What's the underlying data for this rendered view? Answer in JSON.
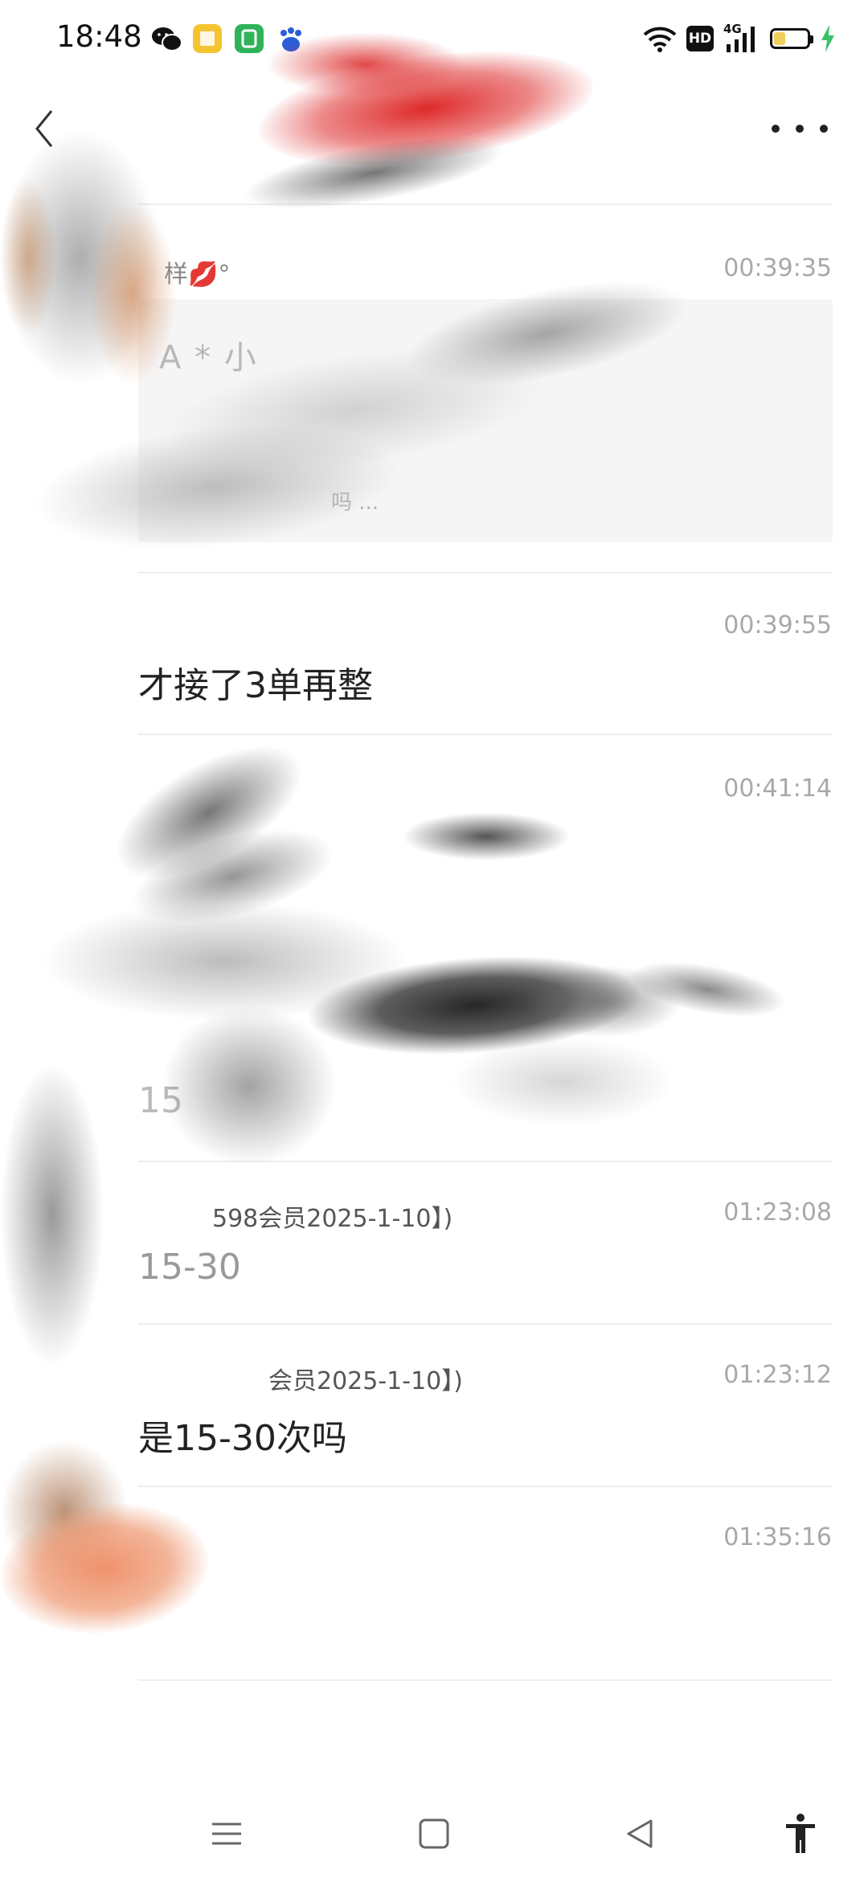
{
  "status_bar": {
    "time": "18:48",
    "app_icons": [
      "wechat-icon",
      "notes-app-icon",
      "taobao-icon",
      "baidu-icon"
    ],
    "hd_label": "HD",
    "network_label": "4G",
    "battery_level": 0.35,
    "charging": true
  },
  "header": {
    "back_icon": "chevron-left-icon",
    "more_icon": "more-dots-icon"
  },
  "messages": [
    {
      "sender": "样💋°",
      "time": "00:39:35",
      "quote_title": "A * 小",
      "quote_sub": "吗 ..."
    },
    {
      "time": "00:39:55",
      "text": "才接了3单再整"
    },
    {
      "time": "00:41:14",
      "text": "15"
    },
    {
      "sender": "598会员2025-1-10】)",
      "time": "01:23:08",
      "text": "15-30"
    },
    {
      "sender": "会员2025-1-10】)",
      "time": "01:23:12",
      "text": "是15-30次吗"
    },
    {
      "time": "01:35:16"
    }
  ],
  "nav_bar": {
    "menu_icon": "menu-icon",
    "home_icon": "home-square-icon",
    "back_icon": "back-triangle-icon",
    "accessibility_icon": "accessibility-icon"
  },
  "colors": {
    "accent_battery": "#f1cf5c",
    "charging_bolt": "#3cc06a",
    "divider": "#eeeeee",
    "timestamp": "#a8a8a8"
  }
}
